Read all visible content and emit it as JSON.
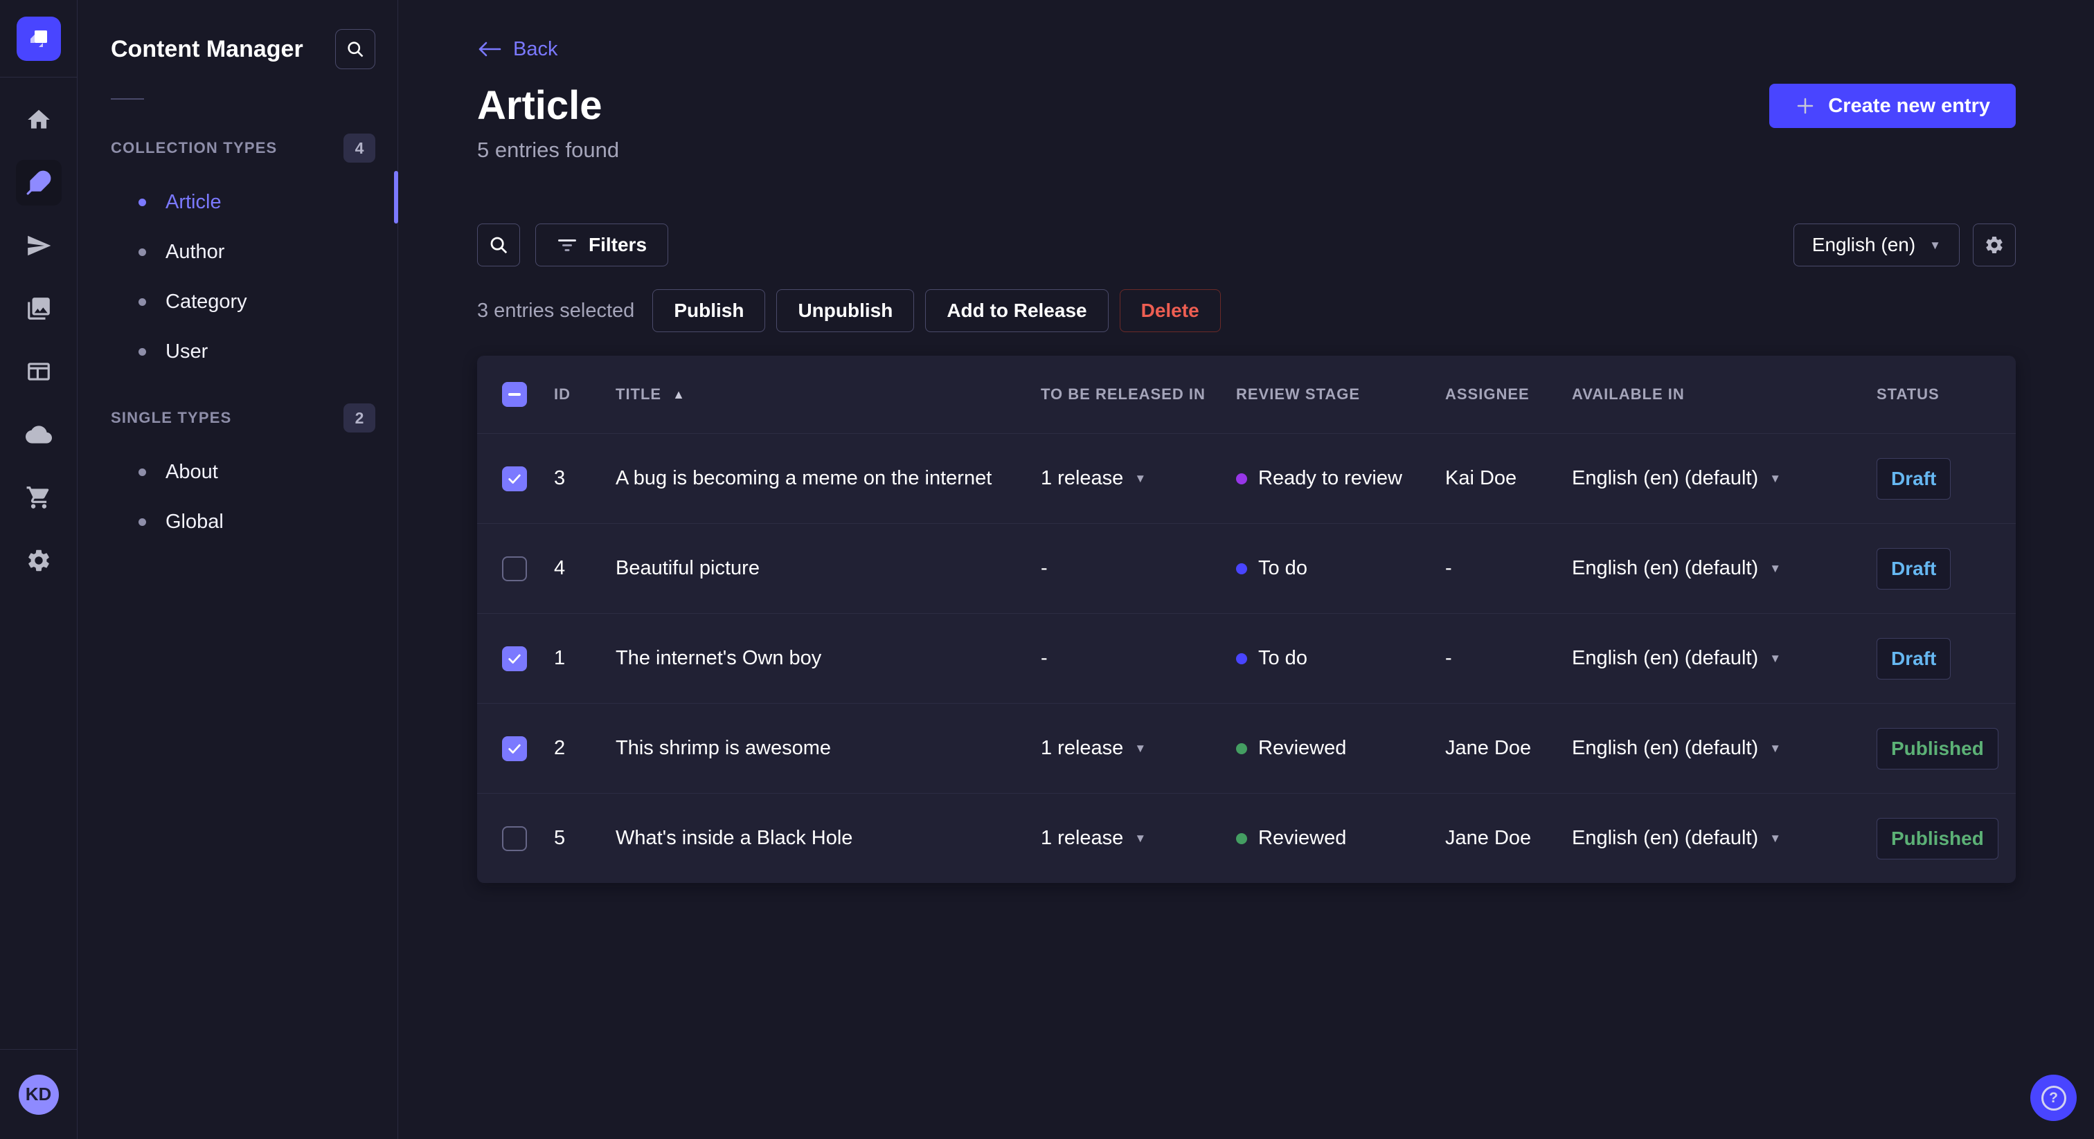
{
  "colors": {
    "brand": "#4945ff",
    "accent_light": "#7b79ff",
    "surface": "#212134",
    "background": "#181826",
    "draft": "#66b7f1",
    "published": "#5cb176",
    "danger": "#ee5e52"
  },
  "rail": {
    "items": [
      {
        "name": "home",
        "active": false
      },
      {
        "name": "content-manager",
        "active": true
      },
      {
        "name": "releases",
        "active": false
      },
      {
        "name": "media-library",
        "active": false
      },
      {
        "name": "content-type-builder",
        "active": false
      },
      {
        "name": "deploy",
        "active": false
      },
      {
        "name": "marketplace",
        "active": false
      },
      {
        "name": "settings",
        "active": false
      }
    ],
    "user_initials": "KD"
  },
  "sidebar": {
    "title": "Content Manager",
    "sections": [
      {
        "label": "COLLECTION TYPES",
        "count": "4",
        "items": [
          {
            "label": "Article",
            "active": true
          },
          {
            "label": "Author",
            "active": false
          },
          {
            "label": "Category",
            "active": false
          },
          {
            "label": "User",
            "active": false
          }
        ]
      },
      {
        "label": "SINGLE TYPES",
        "count": "2",
        "items": [
          {
            "label": "About",
            "active": false
          },
          {
            "label": "Global",
            "active": false
          }
        ]
      }
    ]
  },
  "header": {
    "back_label": "Back",
    "title": "Article",
    "subtitle": "5 entries found",
    "create_button": "Create new entry"
  },
  "toolbar": {
    "filters_label": "Filters",
    "locale_selected": "English (en)"
  },
  "selection": {
    "text": "3 entries selected",
    "publish": "Publish",
    "unpublish": "Unpublish",
    "add_to_release": "Add to Release",
    "delete": "Delete"
  },
  "table": {
    "select_all_state": "indeterminate",
    "sort": {
      "column": "TITLE",
      "direction": "asc"
    },
    "columns": {
      "id": "ID",
      "title": "TITLE",
      "release": "TO BE RELEASED IN",
      "stage": "REVIEW STAGE",
      "assignee": "ASSIGNEE",
      "available": "AVAILABLE IN",
      "status": "STATUS"
    },
    "rows": [
      {
        "checked": true,
        "id": "3",
        "title": "A bug is becoming a meme on the internet",
        "release": "1 release",
        "has_release": true,
        "stage": "Ready to review",
        "stage_color": "#9736e8",
        "assignee": "Kai Doe",
        "available": "English (en) (default)",
        "status": "Draft",
        "status_color": "#66b7f1"
      },
      {
        "checked": false,
        "id": "4",
        "title": "Beautiful picture",
        "release": "-",
        "has_release": false,
        "stage": "To do",
        "stage_color": "#4945ff",
        "assignee": "-",
        "available": "English (en) (default)",
        "status": "Draft",
        "status_color": "#66b7f1"
      },
      {
        "checked": true,
        "id": "1",
        "title": "The internet's Own boy",
        "release": "-",
        "has_release": false,
        "stage": "To do",
        "stage_color": "#4945ff",
        "assignee": "-",
        "available": "English (en) (default)",
        "status": "Draft",
        "status_color": "#66b7f1"
      },
      {
        "checked": true,
        "id": "2",
        "title": "This shrimp is awesome",
        "release": "1 release",
        "has_release": true,
        "stage": "Reviewed",
        "stage_color": "#449e62",
        "assignee": "Jane Doe",
        "available": "English (en) (default)",
        "status": "Published",
        "status_color": "#5cb176"
      },
      {
        "checked": false,
        "id": "5",
        "title": "What's inside a Black Hole",
        "release": "1 release",
        "has_release": true,
        "stage": "Reviewed",
        "stage_color": "#449e62",
        "assignee": "Jane Doe",
        "available": "English (en) (default)",
        "status": "Published",
        "status_color": "#5cb176"
      }
    ]
  },
  "glyphs": {
    "sort_asc": "▲",
    "caret_down": "▼",
    "help": "?"
  }
}
